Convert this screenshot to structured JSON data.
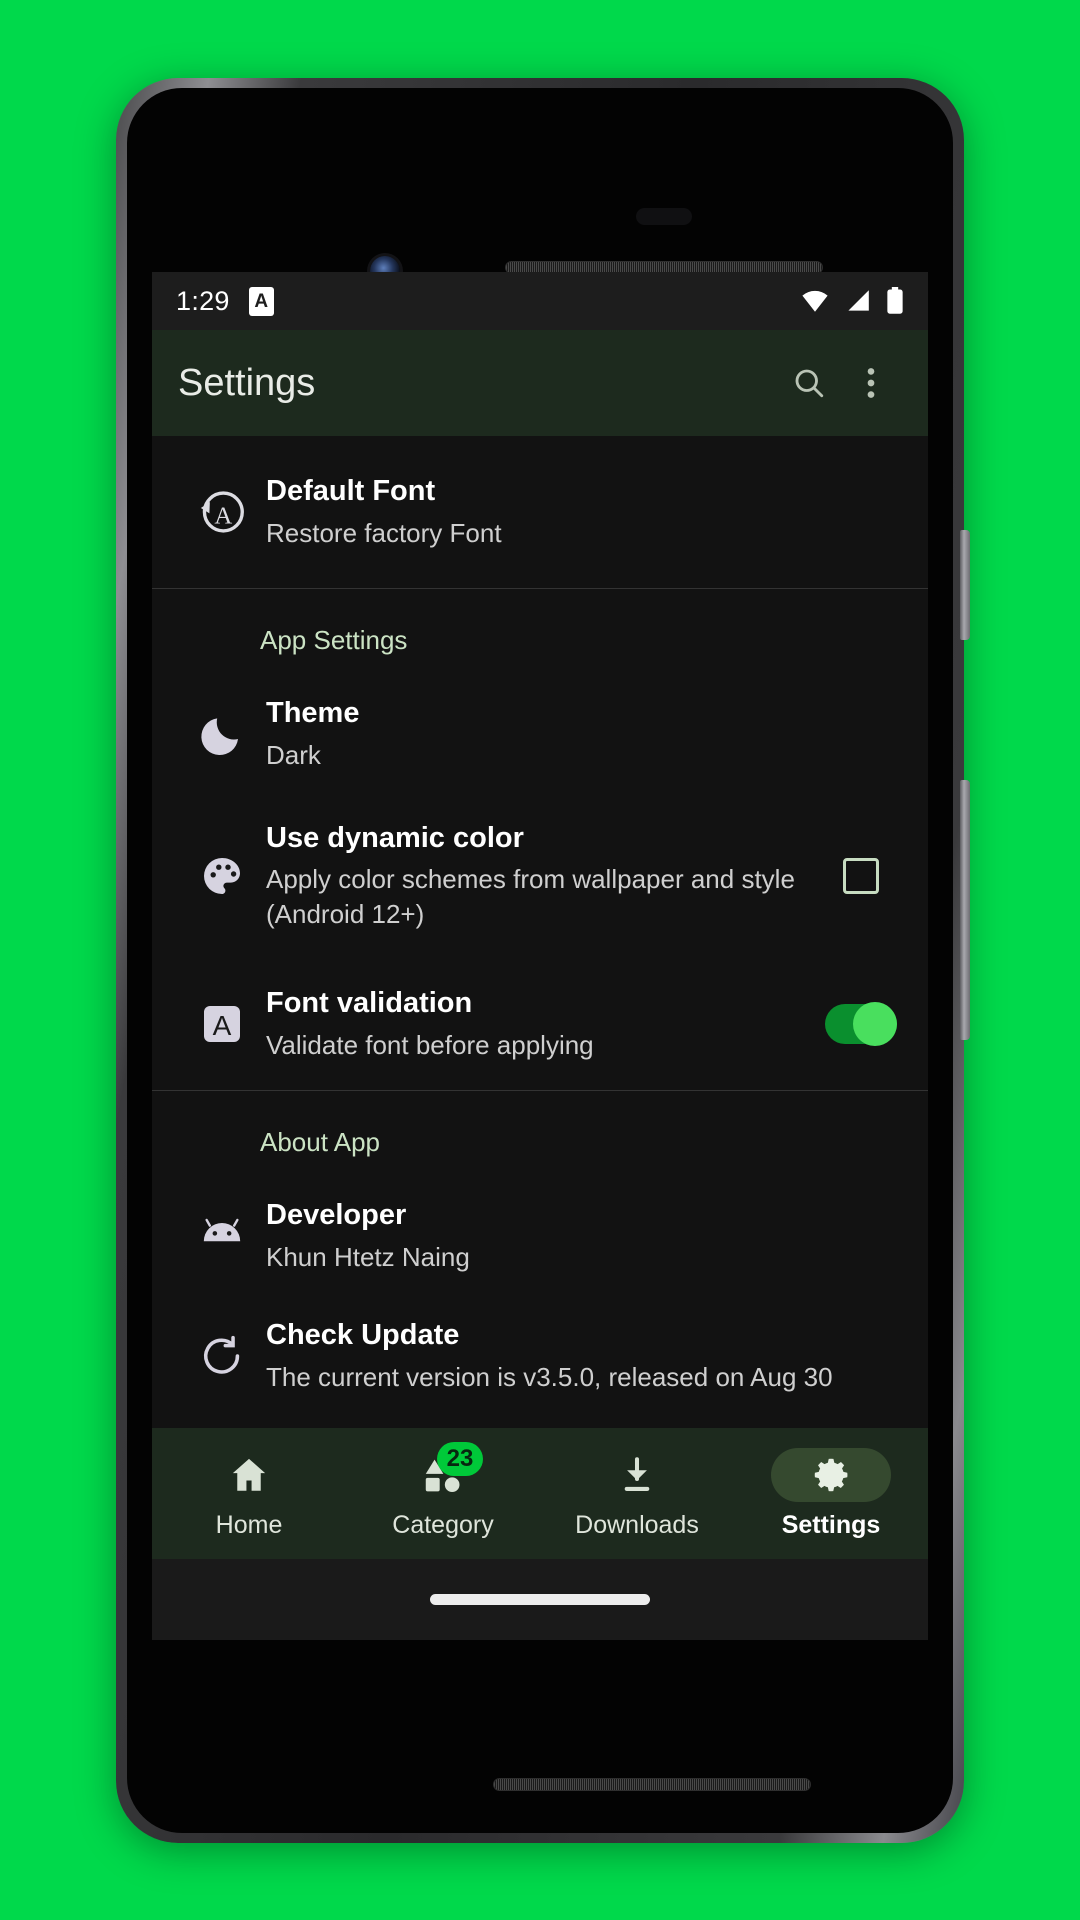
{
  "background_color": "#00D94B",
  "device": {
    "frame_name": "android-phone",
    "front_camera": "camera-icon",
    "earpiece": "speaker-grille"
  },
  "status_bar": {
    "time": "1:29",
    "app_icon_letter": "A",
    "icons": [
      "wifi-icon",
      "cellular-signal-icon",
      "battery-icon"
    ]
  },
  "app_bar": {
    "title": "Settings",
    "search_icon": "search-icon",
    "overflow_icon": "more-vertical-icon",
    "background": "#1d2a1e"
  },
  "settings": {
    "top_item": {
      "icon": "restore-font-icon",
      "title": "Default Font",
      "subtitle": "Restore factory Font"
    },
    "sections": [
      {
        "header": "App Settings",
        "items": [
          {
            "icon": "moon-icon",
            "title": "Theme",
            "subtitle": "Dark",
            "control": "none"
          },
          {
            "icon": "palette-icon",
            "title": "Use dynamic color",
            "subtitle": "Apply color schemes from wallpaper and style (Android 12+)",
            "control": "checkbox",
            "checked": false
          },
          {
            "icon": "font-a-icon",
            "title": "Font validation",
            "subtitle": "Validate font before applying",
            "control": "switch",
            "checked": true
          }
        ]
      },
      {
        "header": "About App",
        "items": [
          {
            "icon": "android-icon",
            "title": "Developer",
            "subtitle": "Khun Htetz Naing",
            "control": "none"
          },
          {
            "icon": "update-icon",
            "title": "Check Update",
            "subtitle": "The current version is v3.5.0, released on Aug 30",
            "control": "none"
          }
        ]
      }
    ]
  },
  "bottom_nav": {
    "items": [
      {
        "icon": "home-icon",
        "label": "Home",
        "active": false,
        "badge": null
      },
      {
        "icon": "category-shapes-icon",
        "label": "Category",
        "active": false,
        "badge": "23"
      },
      {
        "icon": "download-icon",
        "label": "Downloads",
        "active": false,
        "badge": null
      },
      {
        "icon": "gear-icon",
        "label": "Settings",
        "active": true,
        "badge": null
      }
    ],
    "badge_color": "#00C939",
    "active_indicator_color": "#35492f"
  },
  "gesture_bar": {
    "name": "home-gesture-pill"
  }
}
